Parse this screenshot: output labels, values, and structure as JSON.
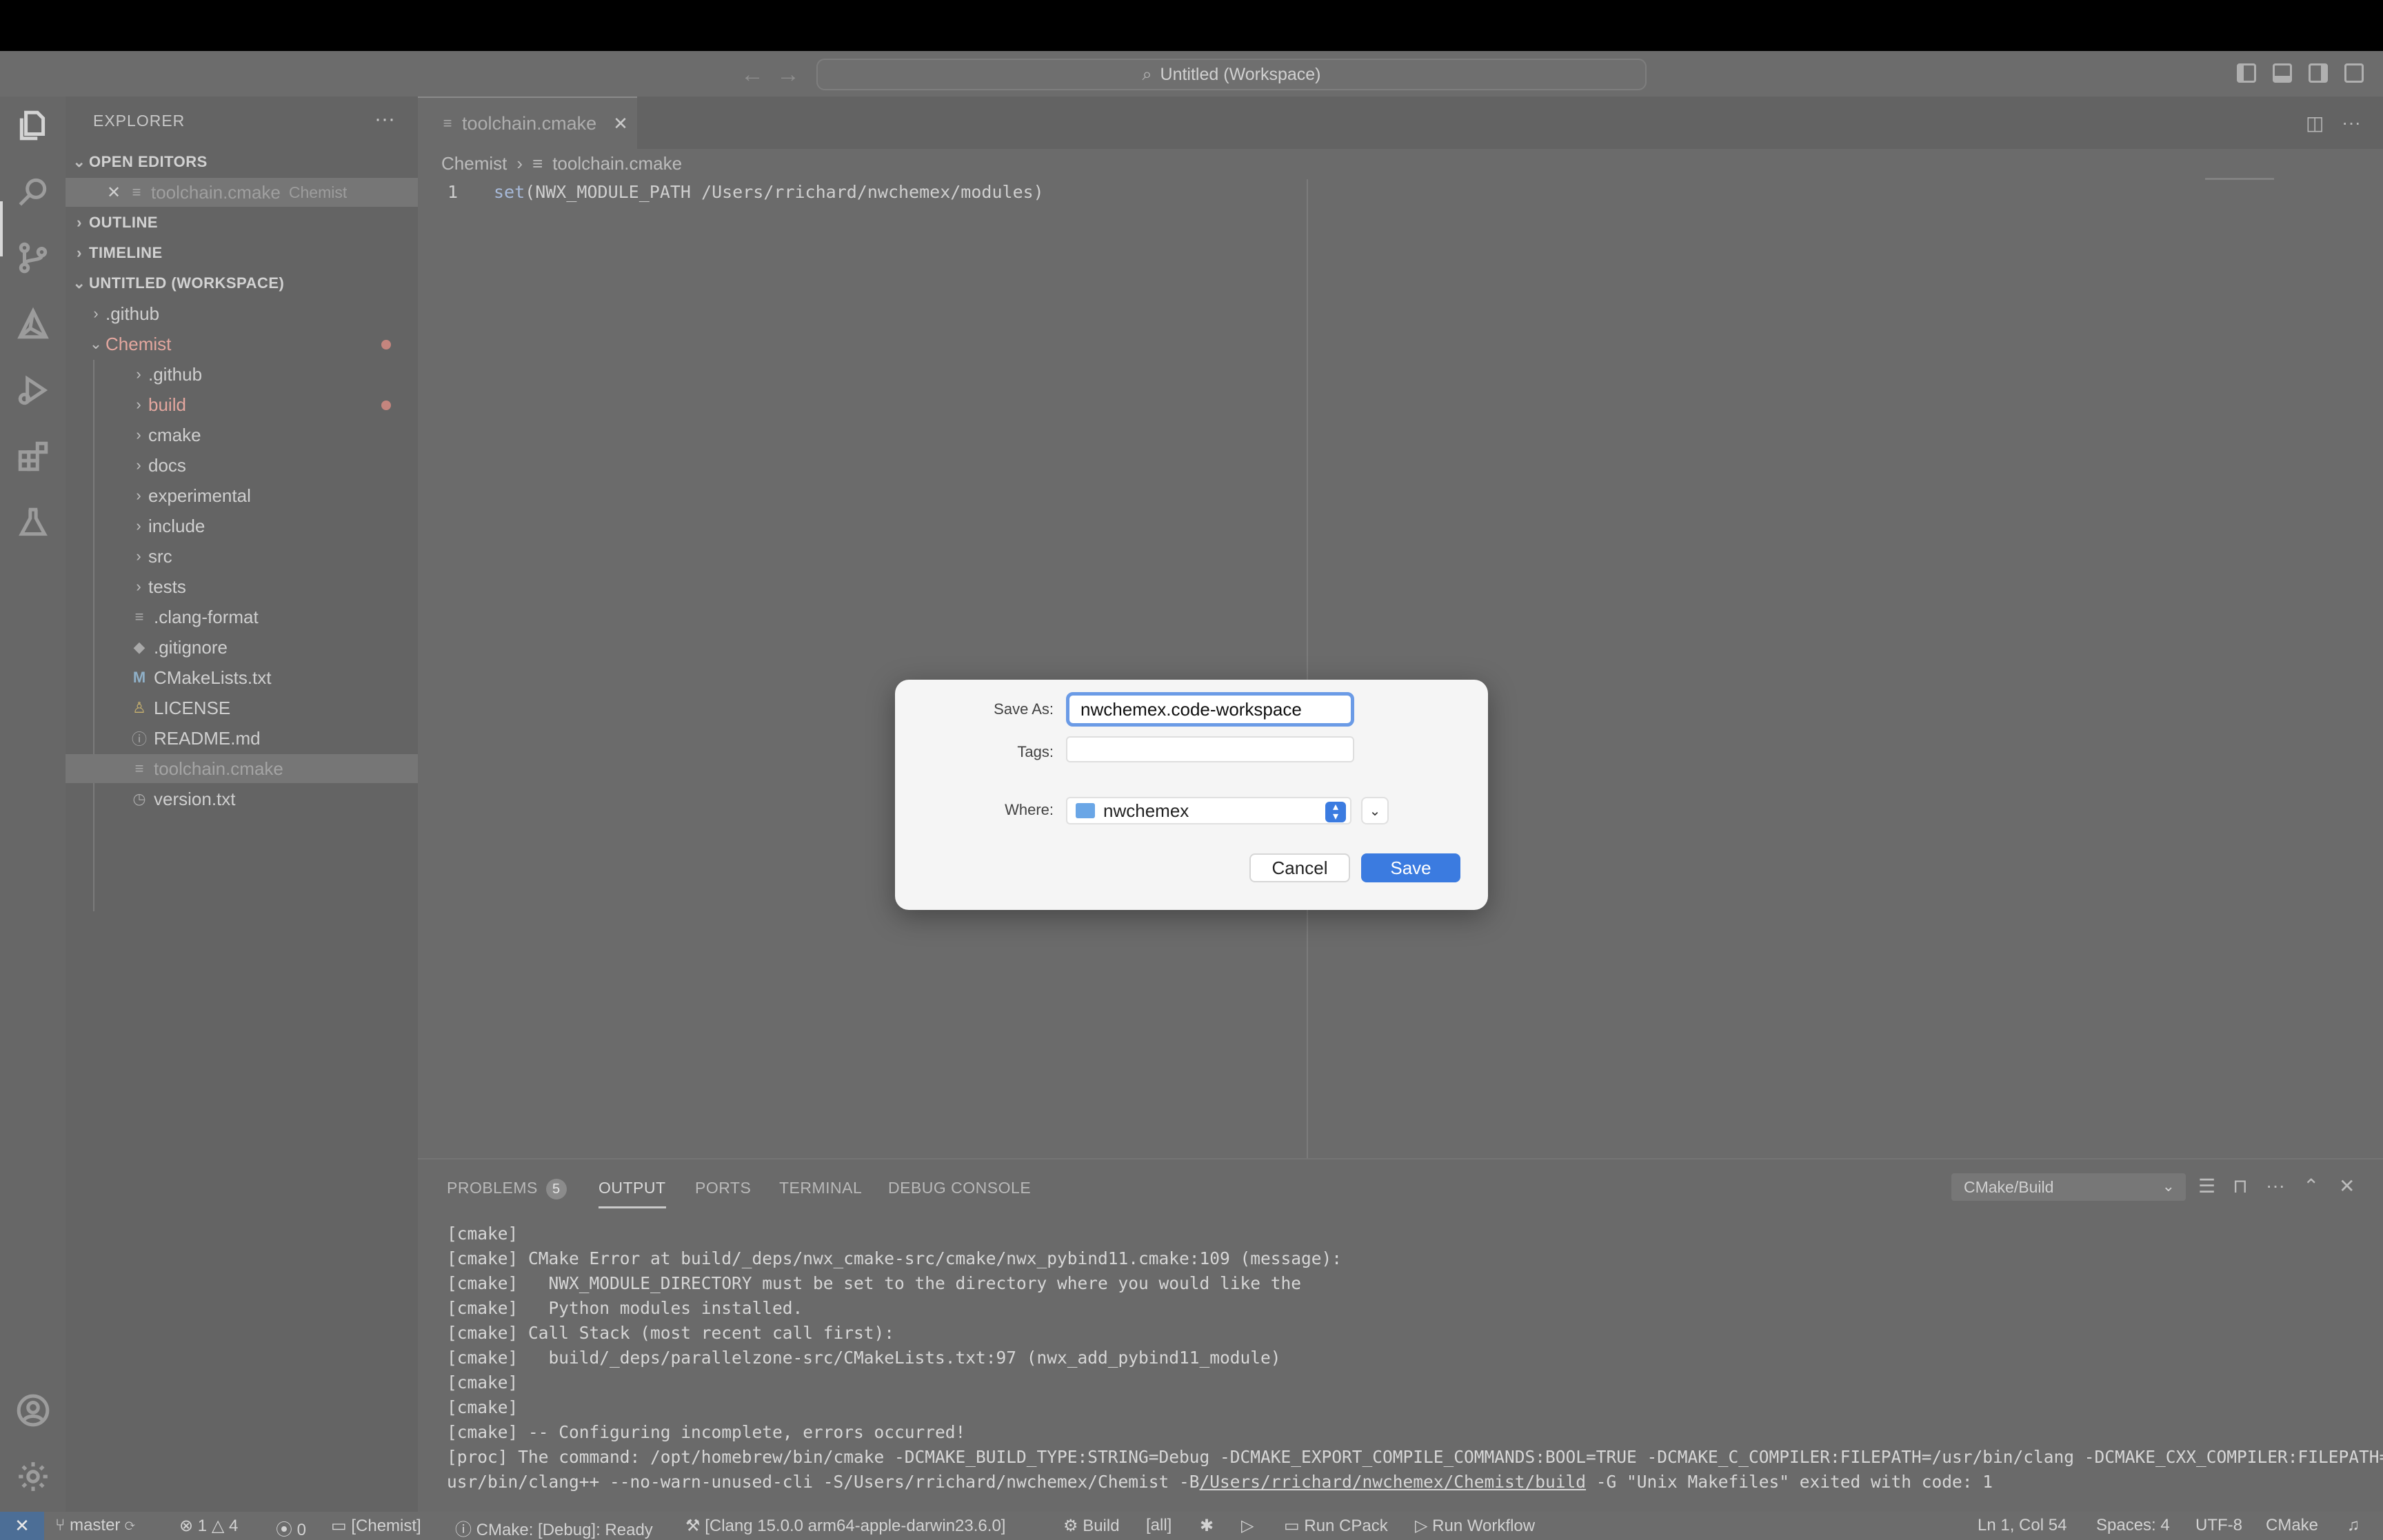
{
  "window": {
    "title": "Untitled (Workspace)",
    "back_icon": "arrow-left-icon",
    "forward_icon": "arrow-right-icon"
  },
  "activity_bar": {
    "items": [
      "explorer-icon",
      "search-icon",
      "source-control-icon",
      "cmake-icon",
      "run-debug-icon",
      "extensions-icon",
      "testing-icon"
    ],
    "bottom": [
      "account-icon",
      "manage-gear-icon"
    ]
  },
  "sidebar": {
    "title": "EXPLORER",
    "more": "···",
    "open_editors": {
      "label": "OPEN EDITORS",
      "items": [
        {
          "name": "toolchain.cmake",
          "folder": "Chemist",
          "close": "✕"
        }
      ]
    },
    "outline": "OUTLINE",
    "timeline": "TIMELINE",
    "workspace": {
      "label": "UNTITLED (WORKSPACE)",
      "root_items": [
        {
          "name": ".github",
          "type": "folder"
        }
      ],
      "chemist": {
        "name": "Chemist",
        "items": [
          {
            "name": ".github",
            "type": "folder"
          },
          {
            "name": "build",
            "type": "folder"
          },
          {
            "name": "cmake",
            "type": "folder"
          },
          {
            "name": "docs",
            "type": "folder"
          },
          {
            "name": "experimental",
            "type": "folder"
          },
          {
            "name": "include",
            "type": "folder"
          },
          {
            "name": "src",
            "type": "folder"
          },
          {
            "name": "tests",
            "type": "folder"
          },
          {
            "name": ".clang-format",
            "type": "file"
          },
          {
            "name": ".gitignore",
            "type": "file"
          },
          {
            "name": "CMakeLists.txt",
            "type": "file"
          },
          {
            "name": "LICENSE",
            "type": "file"
          },
          {
            "name": "README.md",
            "type": "file"
          },
          {
            "name": "toolchain.cmake",
            "type": "file"
          },
          {
            "name": "version.txt",
            "type": "file"
          }
        ]
      }
    }
  },
  "editor": {
    "tab": {
      "name": "toolchain.cmake",
      "close": "✕"
    },
    "breadcrumb": [
      "Chemist",
      "toolchain.cmake"
    ],
    "lines": [
      {
        "num": "1",
        "keyword": "set",
        "rest": "(NWX_MODULE_PATH /Users/rrichard/nwchemex/modules)"
      }
    ]
  },
  "panel": {
    "tabs": [
      {
        "label": "PROBLEMS",
        "badge": "5"
      },
      {
        "label": "OUTPUT"
      },
      {
        "label": "PORTS"
      },
      {
        "label": "TERMINAL"
      },
      {
        "label": "DEBUG CONSOLE"
      }
    ],
    "output_channel": "CMake/Build",
    "output_lines": [
      "[cmake]",
      "[cmake] CMake Error at build/_deps/nwx_cmake-src/cmake/nwx_pybind11.cmake:109 (message):",
      "[cmake]   NWX_MODULE_DIRECTORY must be set to the directory where you would like the",
      "[cmake]   Python modules installed.",
      "[cmake] Call Stack (most recent call first):",
      "[cmake]   build/_deps/parallelzone-src/CMakeLists.txt:97 (nwx_add_pybind11_module)",
      "[cmake]",
      "[cmake]",
      "[cmake] -- Configuring incomplete, errors occurred!",
      "[proc] The command: /opt/homebrew/bin/cmake -DCMAKE_BUILD_TYPE:STRING=Debug -DCMAKE_EXPORT_COMPILE_COMMANDS:BOOL=TRUE -DCMAKE_C_COMPILER:FILEPATH=/usr/bin/clang -DCMAKE_CXX_COMPILER:FILEPATH=/"
    ],
    "last_line": {
      "pre": "usr/bin/clang++ --no-warn-unused-cli -S/Users/rrichard/nwchemex/Chemist -B",
      "link": "/Users/rrichard/nwchemex/Chemist/build",
      "post": " -G \"Unix Makefiles\" exited with code: 1"
    }
  },
  "statusbar": {
    "remote": "✕",
    "branch": "master",
    "errors": "1",
    "warnings": "4",
    "ports": "0",
    "folder": "[Chemist]",
    "cmake_status": "CMake: [Debug]: Ready",
    "kit": "[Clang 15.0.0 arm64-apple-darwin23.6.0]",
    "build": "Build",
    "target": "[all]",
    "run_cpack": "Run CPack",
    "run_workflow": "Run Workflow",
    "position": "Ln 1, Col 54",
    "spaces": "Spaces: 4",
    "encoding": "UTF-8",
    "language": "CMake"
  },
  "dialog": {
    "save_as_label": "Save As:",
    "save_as_value": "nwchemex.code-workspace",
    "tags_label": "Tags:",
    "where_label": "Where:",
    "where_value": "nwchemex",
    "cancel": "Cancel",
    "save": "Save",
    "accent": "#3b7be0"
  }
}
